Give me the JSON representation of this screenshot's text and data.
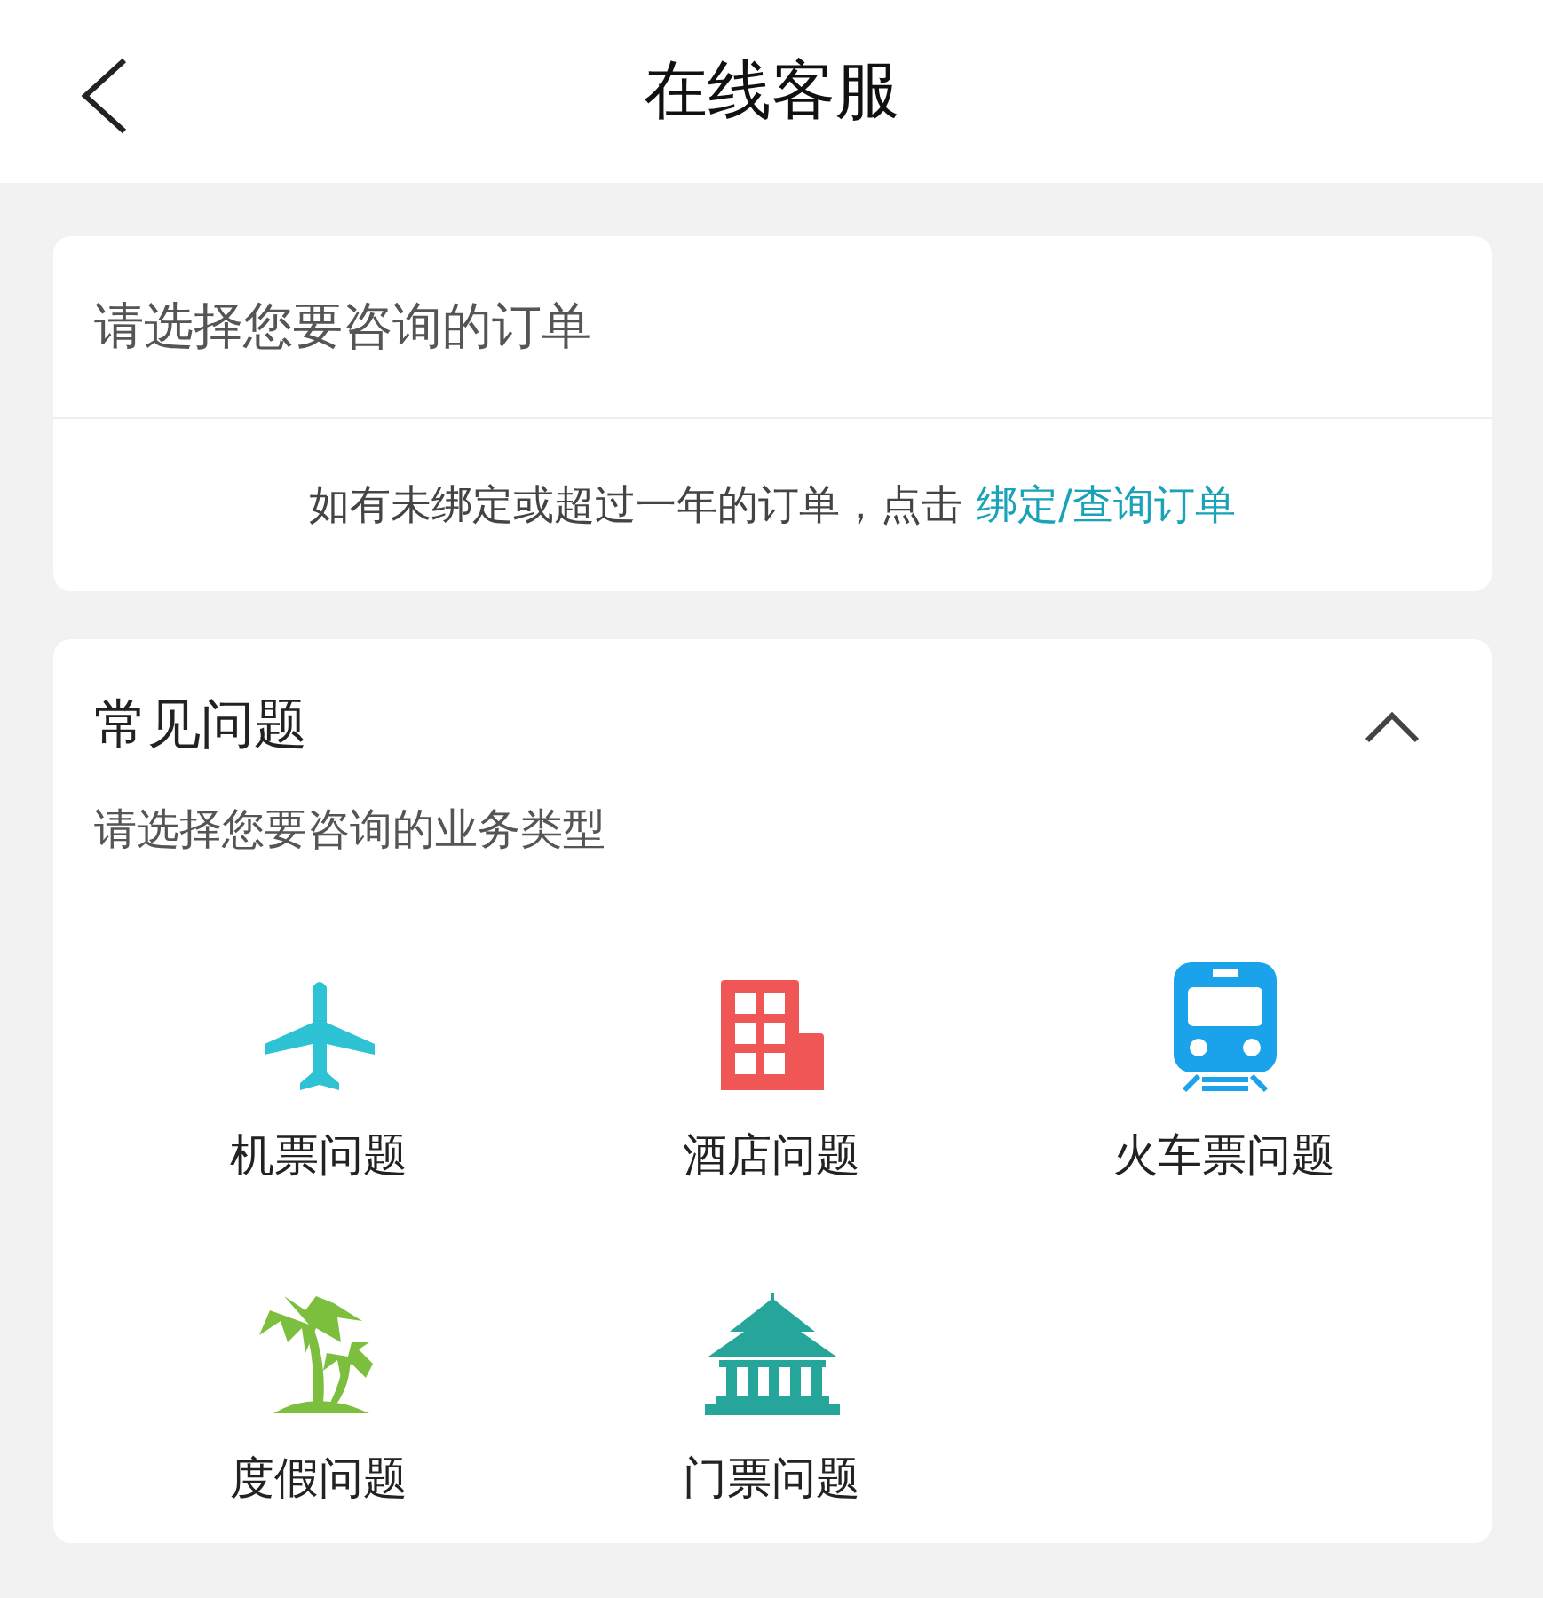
{
  "header": {
    "title": "在线客服"
  },
  "order": {
    "prompt": "请选择您要咨询的订单",
    "note": "如有未绑定或超过一年的订单，点击",
    "link": "绑定/查询订单"
  },
  "faq": {
    "title": "常见问题",
    "expanded": true,
    "subtitle": "请选择您要咨询的业务类型",
    "categories": [
      {
        "kind": "plane",
        "label": "机票问题",
        "color": "#2ec3d4"
      },
      {
        "kind": "hotel",
        "label": "酒店问题",
        "color": "#f05656"
      },
      {
        "kind": "train",
        "label": "火车票问题",
        "color": "#1aa3ea"
      },
      {
        "kind": "palm",
        "label": "度假问题",
        "color": "#7cbf3e"
      },
      {
        "kind": "temple",
        "label": "门票问题",
        "color": "#26a69a"
      }
    ]
  }
}
